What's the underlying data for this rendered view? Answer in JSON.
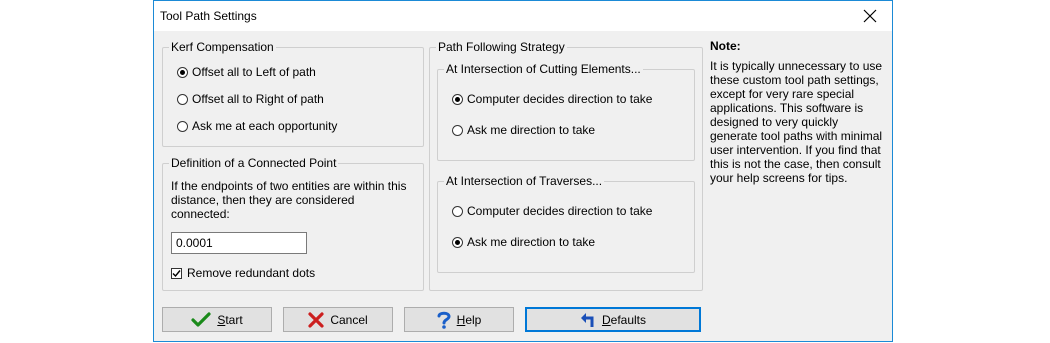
{
  "window": {
    "title": "Tool Path Settings"
  },
  "kerf": {
    "legend": "Kerf Compensation",
    "options": [
      {
        "label": "Offset all to Left of path",
        "selected": true
      },
      {
        "label": "Offset all to Right of path",
        "selected": false
      },
      {
        "label": "Ask me at each opportunity",
        "selected": false
      }
    ]
  },
  "connected_point": {
    "legend": "Definition of a Connected Point",
    "description": "If the endpoints of two entities are within this distance, then they are considered connected:",
    "distance_value": "0.0001",
    "remove_dots_label": "Remove redundant dots",
    "remove_dots_checked": true
  },
  "strategy": {
    "legend": "Path Following Strategy",
    "cutting": {
      "legend": "At Intersection of Cutting Elements...",
      "options": [
        {
          "label": "Computer decides direction to take",
          "selected": true
        },
        {
          "label": "Ask me direction to take",
          "selected": false
        }
      ]
    },
    "traverses": {
      "legend": "At Intersection of Traverses...",
      "options": [
        {
          "label": "Computer decides direction to take",
          "selected": false
        },
        {
          "label": "Ask me direction to take",
          "selected": true
        }
      ]
    }
  },
  "note": {
    "title": "Note:",
    "body": "It is typically unnecessary to use these custom tool path settings, except for very rare special applications. This software is designed to very quickly generate tool paths with minimal user intervention.  If you find that this is not the case, then consult your help screens for tips."
  },
  "buttons": {
    "start": {
      "label": "Start",
      "mnemonic": "S",
      "rest": "tart",
      "icon": "checkmark-icon",
      "icon_color": "#1a8a1a"
    },
    "cancel": {
      "label": "Cancel",
      "icon": "x-icon",
      "icon_color": "#cc1f1f"
    },
    "help": {
      "label": "Help",
      "mnemonic": "H",
      "rest": "elp",
      "icon": "question-icon",
      "icon_color": "#1a5fc9"
    },
    "defaults": {
      "label": "Defaults",
      "mnemonic": "D",
      "rest": "efaults",
      "icon": "undo-arrow-icon",
      "icon_color": "#1a4fb8"
    }
  }
}
